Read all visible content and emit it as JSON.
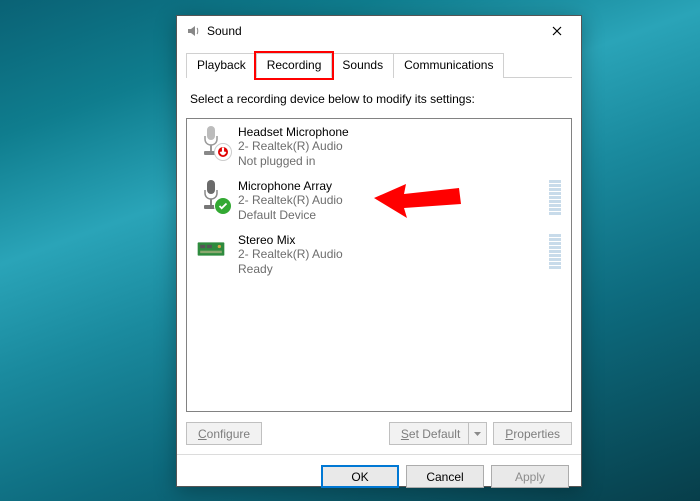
{
  "window": {
    "title": "Sound"
  },
  "tabs": {
    "items": [
      {
        "label": "Playback"
      },
      {
        "label": "Recording"
      },
      {
        "label": "Sounds"
      },
      {
        "label": "Communications"
      }
    ]
  },
  "instruction": "Select a recording device below to modify its settings:",
  "devices": [
    {
      "name": "Headset Microphone",
      "subtitle": "2- Realtek(R) Audio",
      "status": "Not plugged in"
    },
    {
      "name": "Microphone Array",
      "subtitle": "2- Realtek(R) Audio",
      "status": "Default Device"
    },
    {
      "name": "Stereo Mix",
      "subtitle": "2- Realtek(R) Audio",
      "status": "Ready"
    }
  ],
  "buttons": {
    "configure": "Configure",
    "set_default": "Set Default",
    "properties": "Properties"
  },
  "footer": {
    "ok": "OK",
    "cancel": "Cancel",
    "apply": "Apply"
  }
}
